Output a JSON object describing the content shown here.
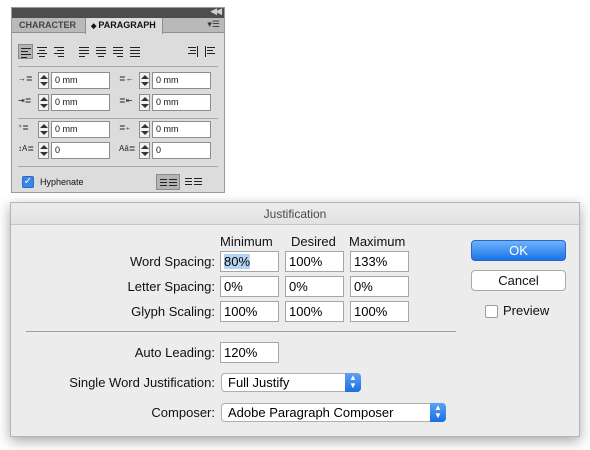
{
  "panel": {
    "tabs": {
      "character": "CHARACTER",
      "paragraph_arrows": "⬍",
      "paragraph": "PARAGRAPH"
    },
    "collapse_icon": "double-left-arrow",
    "menu_icon": "panel-menu",
    "fields": {
      "left_indent": "0 mm",
      "right_indent": "0 mm",
      "first_line_indent": "0 mm",
      "last_line_indent": "0 mm",
      "space_before": "0 mm",
      "space_after": "0 mm",
      "drop_cap_lines": "0",
      "drop_cap_chars": "0"
    },
    "hyphenate": {
      "label": "Hyphenate",
      "checked": true
    },
    "check_glyph": "✓"
  },
  "dialog": {
    "title": "Justification",
    "columns": {
      "minimum": "Minimum",
      "desired": "Desired",
      "maximum": "Maximum"
    },
    "rows": {
      "word_spacing": {
        "label": "Word Spacing:",
        "min": "80%",
        "desired": "100%",
        "max": "133%"
      },
      "letter_spacing": {
        "label": "Letter Spacing:",
        "min": "0%",
        "desired": "0%",
        "max": "0%"
      },
      "glyph_scaling": {
        "label": "Glyph Scaling:",
        "min": "100%",
        "desired": "100%",
        "max": "100%"
      }
    },
    "auto_leading": {
      "label": "Auto Leading:",
      "value": "120%"
    },
    "single_word": {
      "label": "Single Word Justification:",
      "value": "Full Justify"
    },
    "composer": {
      "label": "Composer:",
      "value": "Adobe Paragraph Composer"
    },
    "buttons": {
      "ok": "OK",
      "cancel": "Cancel"
    },
    "preview": {
      "label": "Preview",
      "checked": false
    },
    "select_arrows": "▲▼",
    "accent_color": "#1a73e8"
  }
}
